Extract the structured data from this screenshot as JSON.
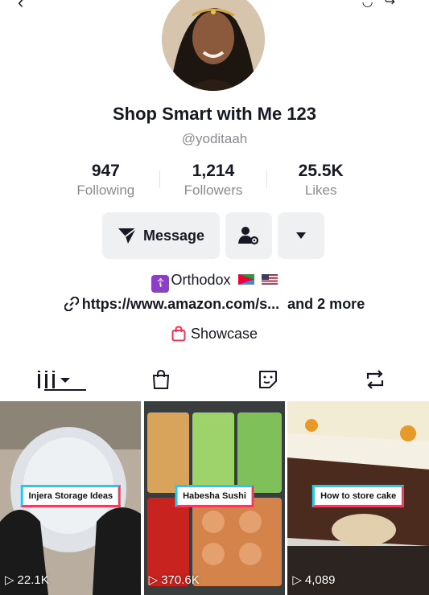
{
  "top_bar": {
    "back_icon": "chevron-left-icon",
    "right_icons": [
      "notification-icon",
      "share-icon"
    ]
  },
  "profile": {
    "display_name": "Shop Smart with Me 123",
    "handle": "@yoditaah"
  },
  "stats": [
    {
      "value": "947",
      "label": "Following"
    },
    {
      "value": "1,214",
      "label": "Followers"
    },
    {
      "value": "25.5K",
      "label": "Likes"
    }
  ],
  "actions": {
    "message_label": "Message",
    "message_icon": "send-icon",
    "friend_icon": "person-settings-icon",
    "more_icon": "caret-down-icon"
  },
  "bio": {
    "text": "Orthodox",
    "cross_symbol": "☦",
    "flags": [
      "eritrea-flag",
      "us-flag"
    ]
  },
  "link": {
    "url": "https://www.amazon.com/s...",
    "more": "and 2 more"
  },
  "showcase": {
    "label": "Showcase",
    "color": "#fe2c55"
  },
  "tabs": [
    {
      "name": "videos",
      "icon": "grid-icon",
      "active": true
    },
    {
      "name": "shop",
      "icon": "bag-icon",
      "active": false
    },
    {
      "name": "stickers",
      "icon": "sticker-icon",
      "active": false
    },
    {
      "name": "reposts",
      "icon": "repost-icon",
      "active": false
    }
  ],
  "videos": [
    {
      "title": "Injera Storage Ideas",
      "views": "22.1K"
    },
    {
      "title": "Habesha Sushi",
      "views": "370.6K"
    },
    {
      "title": "How to store cake",
      "views": "4,089"
    }
  ]
}
